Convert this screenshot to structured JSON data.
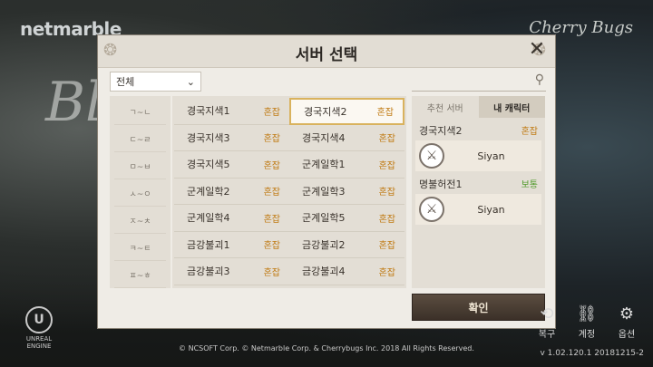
{
  "branding": {
    "left": "netmarble",
    "right": "Cherry Bugs",
    "ue_label": "UNREAL\nENGINE"
  },
  "dialog": {
    "title": "서버 선택",
    "filter_value": "전체",
    "consonant_tabs": [
      "ㄱ~ㄴ",
      "ㄷ~ㄹ",
      "ㅁ~ㅂ",
      "ㅅ~ㅇ",
      "ㅈ~ㅊ",
      "ㅋ~ㅌ",
      "ㅍ~ㅎ"
    ],
    "servers": [
      {
        "name": "경국지색1",
        "status": "혼잡"
      },
      {
        "name": "경국지색2",
        "status": "혼잡"
      },
      {
        "name": "경국지색3",
        "status": "혼잡"
      },
      {
        "name": "경국지색4",
        "status": "혼잡"
      },
      {
        "name": "경국지색5",
        "status": "혼잡"
      },
      {
        "name": "군계일학1",
        "status": "혼잡"
      },
      {
        "name": "군계일학2",
        "status": "혼잡"
      },
      {
        "name": "군계일학3",
        "status": "혼잡"
      },
      {
        "name": "군계일학4",
        "status": "혼잡"
      },
      {
        "name": "군계일학5",
        "status": "혼잡"
      },
      {
        "name": "금강불괴1",
        "status": "혼잡"
      },
      {
        "name": "금강불괴2",
        "status": "혼잡"
      },
      {
        "name": "금강불괴3",
        "status": "혼잡"
      },
      {
        "name": "금강불괴4",
        "status": "혼잡"
      }
    ],
    "right_tabs": {
      "recommended": "추천 서버",
      "my_characters": "내 캐릭터"
    },
    "characters": [
      {
        "server": "경국지색2",
        "status": "혼잡",
        "status_color": "#c07a12",
        "name": "Siyan"
      },
      {
        "server": "명불허전1",
        "status": "보통",
        "status_color": "#4f9a2a",
        "name": "Siyan"
      }
    ],
    "confirm_label": "확인"
  },
  "corner": {
    "restore": "복구",
    "account": "계정",
    "options": "옵션"
  },
  "footer": {
    "copyright": "© NCSOFT Corp. © Netmarble Corp. & Cherrybugs Inc. 2018 All Rights Reserved.",
    "version": "v 1.02.120.1  20181215-2"
  }
}
